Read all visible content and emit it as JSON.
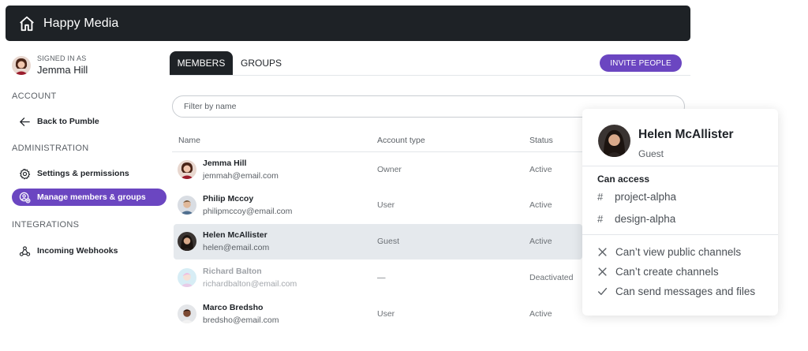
{
  "app": {
    "title": "Happy Media"
  },
  "sidebar": {
    "signed_in_label": "SIGNED IN AS",
    "user_name": "Jemma Hill",
    "sections": {
      "account": "ACCOUNT",
      "administration": "ADMINISTRATION",
      "integrations": "INTEGRATIONS"
    },
    "items": {
      "back": "Back to Pumble",
      "settings": "Settings & permissions",
      "members": "Manage members & groups",
      "webhooks": "Incoming Webhooks"
    }
  },
  "tabs": {
    "members": "MEMBERS",
    "groups": "GROUPS"
  },
  "invite_label": "INVITE PEOPLE",
  "filter_placeholder": "Filter by name",
  "table": {
    "headers": {
      "name": "Name",
      "account_type": "Account type",
      "status": "Status"
    },
    "rows": [
      {
        "name": "Jemma Hill",
        "email": "jemmah@email.com",
        "account_type": "Owner",
        "status": "Active"
      },
      {
        "name": "Philip Mccoy",
        "email": "philipmccoy@email.com",
        "account_type": "User",
        "status": "Active"
      },
      {
        "name": "Helen McAllister",
        "email": "helen@email.com",
        "account_type": "Guest",
        "status": "Active"
      },
      {
        "name": "Richard Balton",
        "email": "richardbalton@email.com",
        "account_type": "—",
        "status": "Deactivated"
      },
      {
        "name": "Marco Bredsho",
        "email": "bredsho@email.com",
        "account_type": "User",
        "status": "Active"
      }
    ]
  },
  "popup": {
    "name": "Helen McAllister",
    "role": "Guest",
    "can_access_label": "Can access",
    "channels": [
      "project-alpha",
      "design-alpha"
    ],
    "permissions": [
      {
        "text": "Can’t view public channels",
        "allowed": false,
        "icon": "x-icon"
      },
      {
        "text": "Can’t create channels",
        "allowed": false,
        "icon": "x-icon"
      },
      {
        "text": "Can send messages and files",
        "allowed": true,
        "icon": "check-icon"
      }
    ]
  },
  "colors": {
    "accent": "#6b46c1",
    "topbar": "#1e2226",
    "highlight_row": "#e5e9ed"
  }
}
